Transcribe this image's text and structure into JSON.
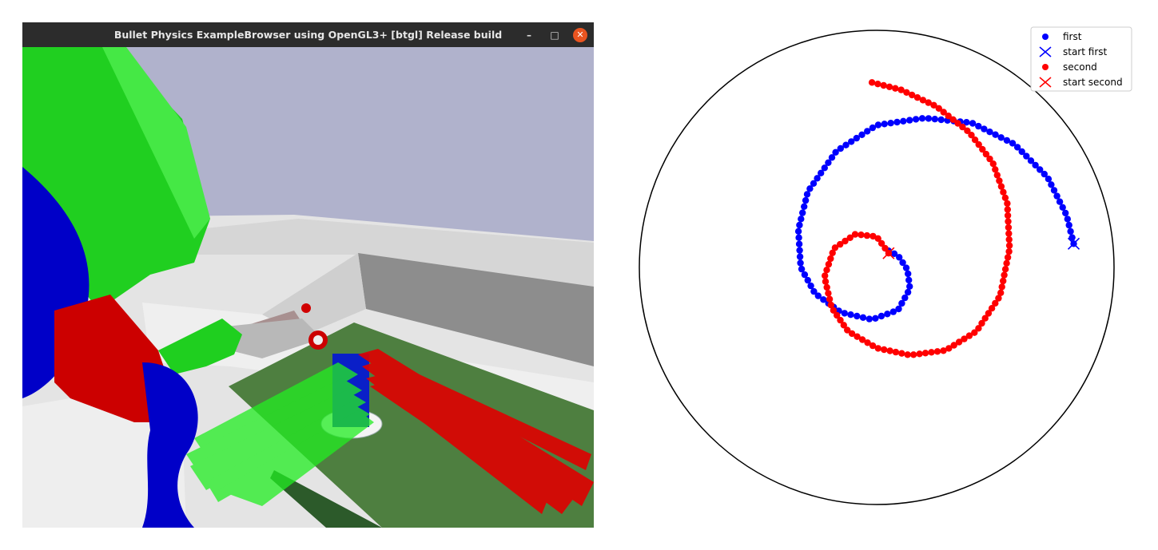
{
  "window": {
    "title": "Bullet Physics ExampleBrowser using OpenGL3+ [btgl] Release build",
    "controls": {
      "minimize": "–",
      "maximize": "□",
      "close": "✕"
    }
  },
  "colors": {
    "titlebar": "#2c2c2c",
    "close_button": "#e95420",
    "sky": "#b0b2cc",
    "robot_green": "#1fd01f",
    "robot_blue": "#0000cc",
    "robot_red": "#cc0000",
    "table": "#4e7f40"
  },
  "chart_data": {
    "type": "scatter",
    "frame": "circle",
    "xlim": [
      -1,
      1
    ],
    "ylim": [
      -1,
      1
    ],
    "grid": false,
    "legend_position": "top-right",
    "legend": [
      {
        "label": "first",
        "marker": "dot",
        "color": "#0000ff"
      },
      {
        "label": "start first",
        "marker": "x",
        "color": "#0000ff"
      },
      {
        "label": "second",
        "marker": "dot",
        "color": "#ff0000"
      },
      {
        "label": "start second",
        "marker": "x",
        "color": "#ff0000"
      }
    ],
    "series": [
      {
        "name": "first",
        "color": "#0000ff",
        "start": [
          0.83,
          0.1
        ],
        "anchors": [
          [
            0.83,
            0.1
          ],
          [
            0.8,
            0.22
          ],
          [
            0.72,
            0.38
          ],
          [
            0.58,
            0.52
          ],
          [
            0.4,
            0.61
          ],
          [
            0.2,
            0.63
          ],
          [
            0.0,
            0.6
          ],
          [
            -0.17,
            0.49
          ],
          [
            -0.29,
            0.32
          ],
          [
            -0.33,
            0.16
          ],
          [
            -0.32,
            0.0
          ],
          [
            -0.26,
            -0.11
          ],
          [
            -0.15,
            -0.19
          ],
          [
            -0.02,
            -0.22
          ],
          [
            0.09,
            -0.18
          ],
          [
            0.14,
            -0.09
          ],
          [
            0.13,
            -0.01
          ],
          [
            0.09,
            0.05
          ],
          [
            0.05,
            0.07
          ]
        ],
        "n_points": 100
      },
      {
        "name": "second",
        "color": "#ff0000",
        "start": [
          0.05,
          0.06
        ],
        "anchors": [
          [
            0.05,
            0.06
          ],
          [
            0.0,
            0.13
          ],
          [
            -0.09,
            0.14
          ],
          [
            -0.18,
            0.08
          ],
          [
            -0.22,
            -0.04
          ],
          [
            -0.19,
            -0.17
          ],
          [
            -0.12,
            -0.27
          ],
          [
            0.0,
            -0.34
          ],
          [
            0.14,
            -0.37
          ],
          [
            0.29,
            -0.35
          ],
          [
            0.42,
            -0.27
          ],
          [
            0.52,
            -0.12
          ],
          [
            0.56,
            0.08
          ],
          [
            0.55,
            0.27
          ],
          [
            0.49,
            0.44
          ],
          [
            0.39,
            0.57
          ],
          [
            0.25,
            0.68
          ],
          [
            0.1,
            0.75
          ],
          [
            -0.02,
            0.78
          ]
        ],
        "n_points": 105
      }
    ]
  }
}
